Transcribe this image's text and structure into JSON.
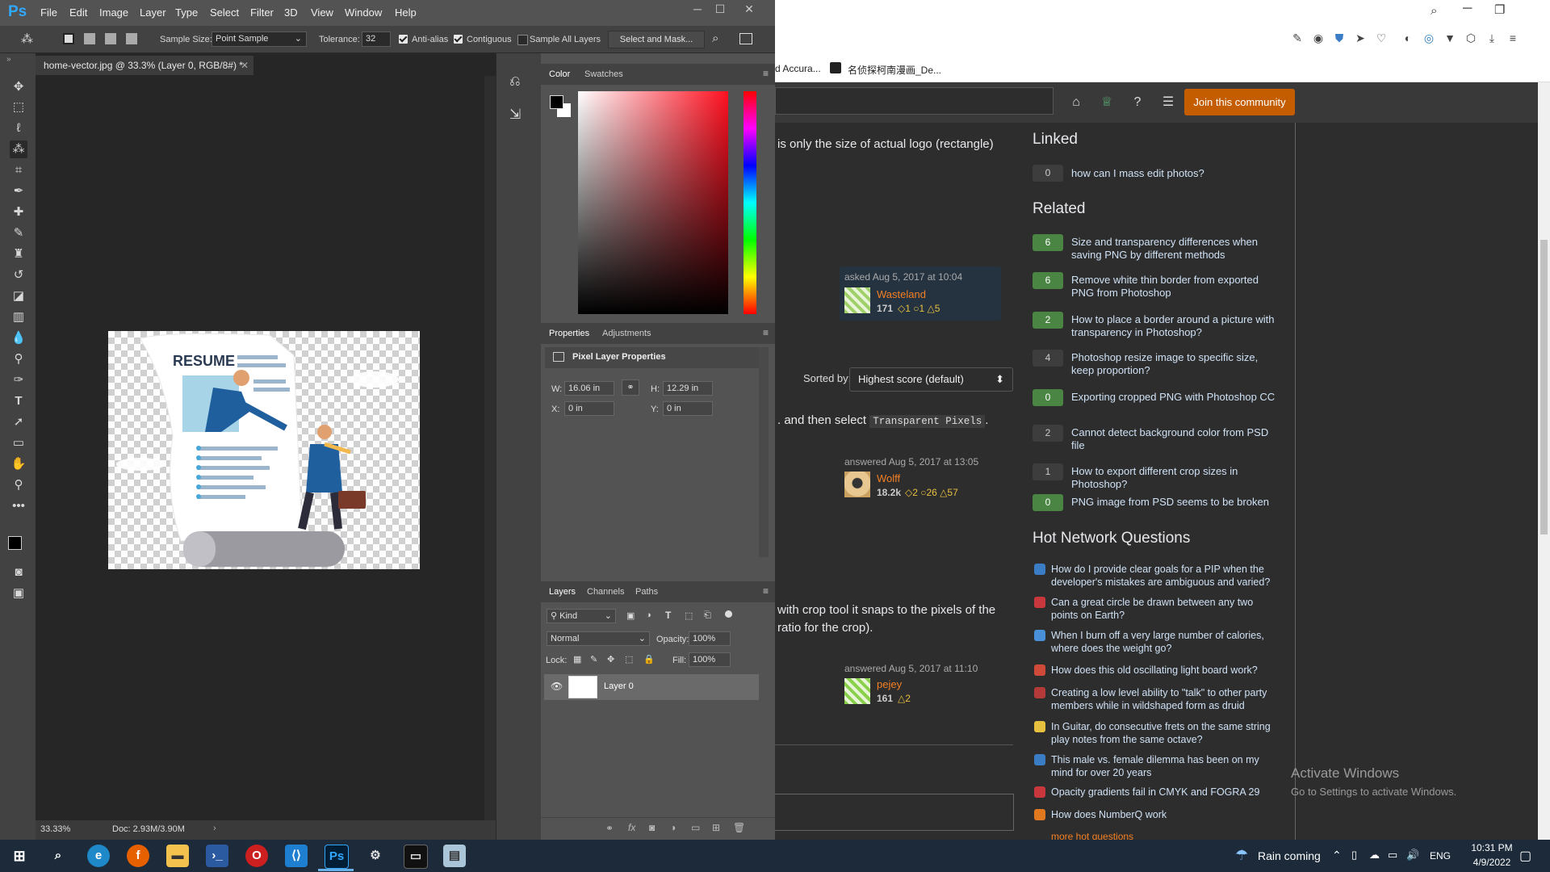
{
  "browser": {
    "bookmarks": [
      "d Accura...",
      "名侦探柯南漫画_De..."
    ],
    "join_button": "Join this community",
    "question_line1": "is only the size of actual logo (rectangle)",
    "asked_card": {
      "label": "asked Aug 5, 2017 at 10:04",
      "user": "Wasteland",
      "rep": "171",
      "badges": "◇1  ○1  △5"
    },
    "sorted_label": "Sorted by:",
    "sort_value": "Highest score (default)",
    "answer1_text_a": ". and then select",
    "answer1_code": "Transparent Pixels",
    "answer1_text_b": ".",
    "answer1_card": {
      "label": "answered Aug 5, 2017 at 13:05",
      "user": "Wolff",
      "rep": "18.2k",
      "badges": "◇2  ○26  △57"
    },
    "answer2_line1": "with crop tool it snaps to the pixels of the",
    "answer2_line2": "ratio for the crop).",
    "answer2_card": {
      "label": "answered Aug 5, 2017 at 11:10",
      "user": "pejey",
      "rep": "161",
      "badges": "△2"
    },
    "linked_heading": "Linked",
    "linked": [
      {
        "score": "0",
        "title": "how can I mass edit photos?"
      }
    ],
    "related_heading": "Related",
    "related": [
      {
        "score": "6",
        "title": "Size and transparency differences when saving PNG by different methods",
        "answered": true
      },
      {
        "score": "6",
        "title": "Remove white thin border from exported PNG from Photoshop",
        "answered": true
      },
      {
        "score": "2",
        "title": "How to place a border around a picture with transparency in Photoshop?",
        "answered": true
      },
      {
        "score": "4",
        "title": "Photoshop resize image to specific size, keep proportion?",
        "answered": false
      },
      {
        "score": "0",
        "title": "Exporting cropped PNG with Photoshop CC",
        "answered": true
      },
      {
        "score": "2",
        "title": "Cannot detect background color from PSD file",
        "answered": false
      },
      {
        "score": "1",
        "title": "How to export different crop sizes in Photoshop?",
        "answered": false
      },
      {
        "score": "0",
        "title": "PNG image from PSD seems to be broken",
        "answered": true
      }
    ],
    "hnq_heading": "Hot Network Questions",
    "hnq": [
      {
        "title": "How do I provide clear goals for a PIP when the developer's mistakes are ambiguous and varied?",
        "color": "#3b7dc4"
      },
      {
        "title": "Can a great circle be drawn between any two points on Earth?",
        "color": "#c8373b"
      },
      {
        "title": "When I burn off a very large number of calories, where does the weight go?",
        "color": "#4a90d9"
      },
      {
        "title": "How does this old oscillating light board work?",
        "color": "#d04a3a"
      },
      {
        "title": "Creating a low level ability to \"talk\" to other party members while in wildshaped form as druid",
        "color": "#b43a3a"
      },
      {
        "title": "In Guitar, do consecutive frets on the same string play notes from the same octave?",
        "color": "#e8c040"
      },
      {
        "title": "This male vs. female dilemma has been on my mind for over 20 years",
        "color": "#3b7dc4"
      },
      {
        "title": "Opacity gradients fail in CMYK and FOGRA 29",
        "color": "#c8373b"
      },
      {
        "title": "How does NumberQ work",
        "color": "#e0781f"
      }
    ],
    "more_hot": "more hot questions",
    "watermark_title": "Activate Windows",
    "watermark_sub": "Go to Settings to activate Windows."
  },
  "photoshop": {
    "logo": "Ps",
    "menus": [
      "File",
      "Edit",
      "Image",
      "Layer",
      "Type",
      "Select",
      "Filter",
      "3D",
      "View",
      "Window",
      "Help"
    ],
    "options": {
      "sample_size_label": "Sample Size:",
      "sample_size_value": "Point Sample",
      "tolerance_label": "Tolerance:",
      "tolerance_value": "32",
      "anti_alias": "Anti-alias",
      "contiguous": "Contiguous",
      "sample_all": "Sample All Layers",
      "select_mask": "Select and Mask..."
    },
    "doc_tab": "home-vector.jpg @ 33.3% (Layer 0, RGB/8#) *",
    "canvas_text": "RESUME",
    "zoom": "33.33%",
    "doc_size": "Doc: 2.93M/3.90M",
    "color_tabs": [
      "Color",
      "Swatches"
    ],
    "properties_tabs": [
      "Properties",
      "Adjustments"
    ],
    "properties_title": "Pixel Layer Properties",
    "props": {
      "w_label": "W:",
      "w": "16.06 in",
      "h_label": "H:",
      "h": "12.29 in",
      "x_label": "X:",
      "x": "0 in",
      "y_label": "Y:",
      "y": "0 in"
    },
    "layers_tabs": [
      "Layers",
      "Channels",
      "Paths"
    ],
    "kind": "Kind",
    "blend_mode": "Normal",
    "opacity_label": "Opacity:",
    "opacity": "100%",
    "lock_label": "Lock:",
    "fill_label": "Fill:",
    "fill": "100%",
    "layer_name": "Layer 0"
  },
  "taskbar": {
    "weather": "Rain coming",
    "lang": "ENG",
    "time": "10:31 PM",
    "date": "4/9/2022"
  },
  "colors": {
    "accent": "#c45c00",
    "ps_blue": "#31a8ff",
    "green_score": "#4a8544"
  }
}
